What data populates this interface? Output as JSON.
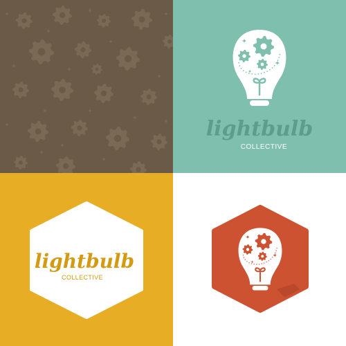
{
  "brand": {
    "wordmark": "lightbulb",
    "tagline": "COLLECTIVE"
  },
  "panels": [
    {
      "name": "gear-pattern-panel",
      "background": "#6b5a47",
      "pattern_color": "#7a6954"
    },
    {
      "name": "teal-logo-panel",
      "background": "#7fbfad",
      "bulb_color": "#ffffff",
      "gear_color": "#7fbfad",
      "wordmark_color": "#5c9d8c",
      "tagline_color": "#ffffff"
    },
    {
      "name": "hexagon-wordmark-panel",
      "background": "#e7ad24",
      "hexagon_color": "#ffffff",
      "wordmark_color": "#d39a12",
      "tagline_color": "#d39a12"
    },
    {
      "name": "hexagon-icon-panel",
      "background": "#ffffff",
      "hexagon_color": "#cc5231",
      "shadow_color": "#b4452a",
      "bulb_color": "#ffffff",
      "gear_color": "#cc5231"
    }
  ]
}
